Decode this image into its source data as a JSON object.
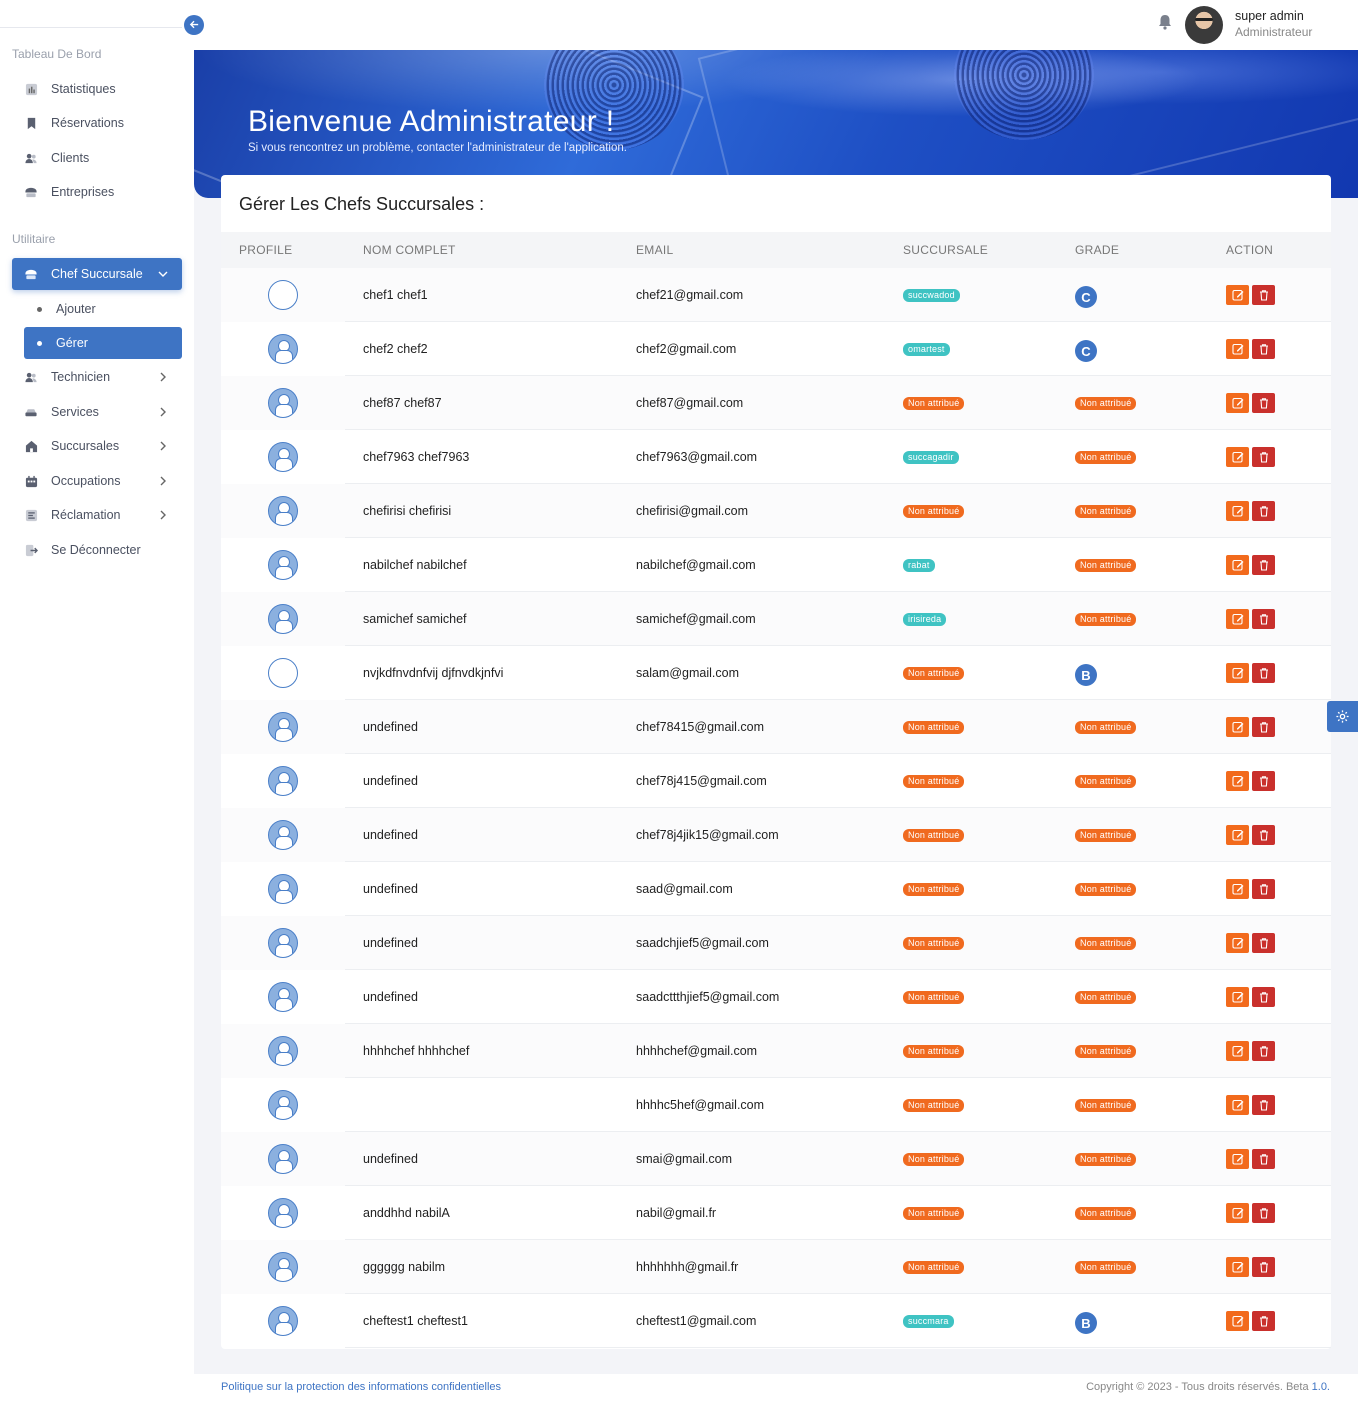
{
  "sidebar": {
    "section1": "Tableau De Bord",
    "section2": "Utilitaire",
    "items": [
      {
        "label": "Statistiques",
        "icon": "chart-icon"
      },
      {
        "label": "Réservations",
        "icon": "bookmark-icon"
      },
      {
        "label": "Clients",
        "icon": "users-icon"
      },
      {
        "label": "Entreprises",
        "icon": "building-icon"
      }
    ],
    "util_items": [
      {
        "label": "Chef Succursale",
        "icon": "chef-hat-icon"
      },
      {
        "label": "Technicien",
        "icon": "users-icon"
      },
      {
        "label": "Services",
        "icon": "car-icon"
      },
      {
        "label": "Succursales",
        "icon": "home-icon"
      },
      {
        "label": "Occupations",
        "icon": "calendar-icon"
      },
      {
        "label": "Réclamation",
        "icon": "list-icon"
      },
      {
        "label": "Se Déconnecter",
        "icon": "logout-icon"
      }
    ],
    "sub_items": [
      "Ajouter",
      "Gérer"
    ]
  },
  "topbar": {
    "user_name": "super admin",
    "user_role": "Administrateur"
  },
  "banner": {
    "title": "Bienvenue Administrateur !",
    "subtitle": "Si vous rencontrez un problème, contacter l'administrateur de l'application."
  },
  "card": {
    "title": "Gérer Les Chefs Succursales :",
    "headers": [
      "PROFILE",
      "NOM COMPLET",
      "EMAIL",
      "SUCCURSALE",
      "GRADE",
      "ACTION"
    ]
  },
  "rows": [
    {
      "avatar": "empty",
      "name": "chef1 chef1",
      "email": "chef21@gmail.com",
      "succ": "succwadod",
      "succ_type": "teal",
      "grade": "C",
      "grade_type": "letter"
    },
    {
      "avatar": "user",
      "name": "chef2 chef2",
      "email": "chef2@gmail.com",
      "succ": "omartest",
      "succ_type": "teal",
      "grade": "C",
      "grade_type": "letter"
    },
    {
      "avatar": "user",
      "name": "chef87 chef87",
      "email": "chef87@gmail.com",
      "succ": "Non attribué",
      "succ_type": "orange",
      "grade": "Non attribué",
      "grade_type": "badge"
    },
    {
      "avatar": "user",
      "name": "chef7963 chef7963",
      "email": "chef7963@gmail.com",
      "succ": "succagadir",
      "succ_type": "teal",
      "grade": "Non attribué",
      "grade_type": "badge"
    },
    {
      "avatar": "user",
      "name": "chefirisi chefirisi",
      "email": "chefirisi@gmail.com",
      "succ": "Non attribué",
      "succ_type": "orange",
      "grade": "Non attribué",
      "grade_type": "badge"
    },
    {
      "avatar": "user",
      "name": "nabilchef nabilchef",
      "email": "nabilchef@gmail.com",
      "succ": "rabat",
      "succ_type": "teal",
      "grade": "Non attribué",
      "grade_type": "badge"
    },
    {
      "avatar": "user",
      "name": "samichef samichef",
      "email": "samichef@gmail.com",
      "succ": "irisireda",
      "succ_type": "teal",
      "grade": "Non attribué",
      "grade_type": "badge"
    },
    {
      "avatar": "empty",
      "name": "nvjkdfnvdnfvij djfnvdkjnfvi",
      "email": "salam@gmail.com",
      "succ": "Non attribué",
      "succ_type": "orange",
      "grade": "B",
      "grade_type": "letter"
    },
    {
      "avatar": "user",
      "name": "undefined",
      "email": "chef78415@gmail.com",
      "succ": "Non attribué",
      "succ_type": "orange",
      "grade": "Non attribué",
      "grade_type": "badge"
    },
    {
      "avatar": "user",
      "name": "undefined",
      "email": "chef78j415@gmail.com",
      "succ": "Non attribué",
      "succ_type": "orange",
      "grade": "Non attribué",
      "grade_type": "badge"
    },
    {
      "avatar": "user",
      "name": "undefined",
      "email": "chef78j4jik15@gmail.com",
      "succ": "Non attribué",
      "succ_type": "orange",
      "grade": "Non attribué",
      "grade_type": "badge"
    },
    {
      "avatar": "user",
      "name": "undefined",
      "email": "saad@gmail.com",
      "succ": "Non attribué",
      "succ_type": "orange",
      "grade": "Non attribué",
      "grade_type": "badge"
    },
    {
      "avatar": "user",
      "name": "undefined",
      "email": "saadchjief5@gmail.com",
      "succ": "Non attribué",
      "succ_type": "orange",
      "grade": "Non attribué",
      "grade_type": "badge"
    },
    {
      "avatar": "user",
      "name": "undefined",
      "email": "saadcttthjief5@gmail.com",
      "succ": "Non attribué",
      "succ_type": "orange",
      "grade": "Non attribué",
      "grade_type": "badge"
    },
    {
      "avatar": "user",
      "name": "hhhhchef hhhhchef",
      "email": "hhhhchef@gmail.com",
      "succ": "Non attribué",
      "succ_type": "orange",
      "grade": "Non attribué",
      "grade_type": "badge"
    },
    {
      "avatar": "user",
      "name": "",
      "email": "hhhhc5hef@gmail.com",
      "succ": "Non attribué",
      "succ_type": "orange",
      "grade": "Non attribué",
      "grade_type": "badge"
    },
    {
      "avatar": "user",
      "name": "undefined",
      "email": "smai@gmail.com",
      "succ": "Non attribué",
      "succ_type": "orange",
      "grade": "Non attribué",
      "grade_type": "badge"
    },
    {
      "avatar": "user",
      "name": "anddhhd nabilA",
      "email": "nabil@gmail.fr",
      "succ": "Non attribué",
      "succ_type": "orange",
      "grade": "Non attribué",
      "grade_type": "badge"
    },
    {
      "avatar": "user",
      "name": "gggggg nabilm",
      "email": "hhhhhhh@gmail.fr",
      "succ": "Non attribué",
      "succ_type": "orange",
      "grade": "Non attribué",
      "grade_type": "badge"
    },
    {
      "avatar": "user",
      "name": "cheftest1 cheftest1",
      "email": "cheftest1@gmail.com",
      "succ": "succmara",
      "succ_type": "teal",
      "grade": "B",
      "grade_type": "letter"
    }
  ],
  "footer": {
    "left": "Politique sur la protection des informations confidentielles",
    "right_prefix": "Copyright © 2023 - Tous droits réservés. Beta ",
    "version": "1.0."
  },
  "colors": {
    "accent": "#3e74c4",
    "badge_teal": "#3fc3c3",
    "badge_orange": "#f06a1f",
    "edit": "#f26a1c",
    "delete": "#c9302c"
  }
}
